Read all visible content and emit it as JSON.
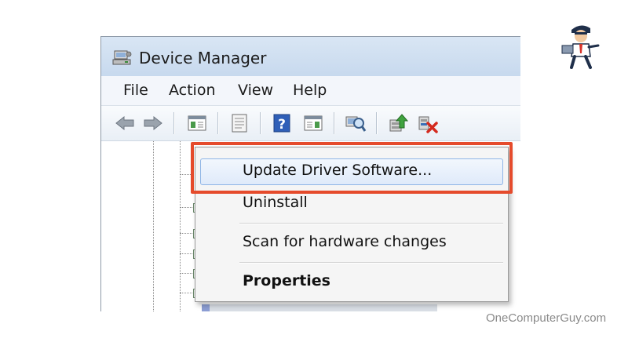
{
  "window": {
    "title": "Device Manager",
    "title_icon": "device-manager-icon"
  },
  "menubar": {
    "items": [
      {
        "label": "File"
      },
      {
        "label": "Action"
      },
      {
        "label": "View"
      },
      {
        "label": "Help"
      }
    ]
  },
  "toolbar": {
    "buttons": [
      "back-arrow-icon",
      "forward-arrow-icon",
      "show-hide-console-tree-icon",
      "properties-icon",
      "help-icon",
      "show-hide-action-pane-icon",
      "scan-hardware-changes-icon",
      "update-driver-icon",
      "uninstall-device-icon"
    ]
  },
  "context_menu": {
    "items": [
      {
        "label": "Update Driver Software...",
        "highlighted": true
      },
      {
        "label": "Uninstall"
      },
      {
        "label": "Scan for hardware changes"
      },
      {
        "label": "Properties",
        "bold": true
      }
    ]
  },
  "colors": {
    "highlight_box": "#e54b2c",
    "hover_background": "#dfeafa",
    "title_bar": "#cfdff0"
  },
  "watermark": {
    "text": "OneComputerGuy.com",
    "logo": "onecomputerguy-logo"
  }
}
